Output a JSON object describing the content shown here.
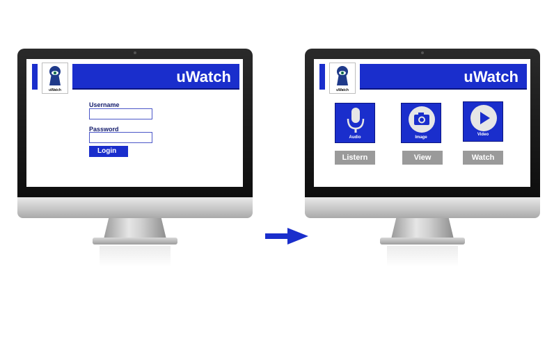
{
  "app": {
    "title": "uWatch",
    "logo_text": "uWatch"
  },
  "login": {
    "username_label": "Username",
    "password_label": "Password",
    "login_label": "Login"
  },
  "media": [
    {
      "icon": "microphone-icon",
      "tile_label": "Audio",
      "button_label": "Listern"
    },
    {
      "icon": "camera-icon",
      "tile_label": "Image",
      "button_label": "View"
    },
    {
      "icon": "play-icon",
      "tile_label": "Video",
      "button_label": "Watch"
    }
  ],
  "colors": {
    "brand": "#1a2ecc",
    "button_gray": "#9a9a9a",
    "arrow": "#1a2ecc"
  }
}
